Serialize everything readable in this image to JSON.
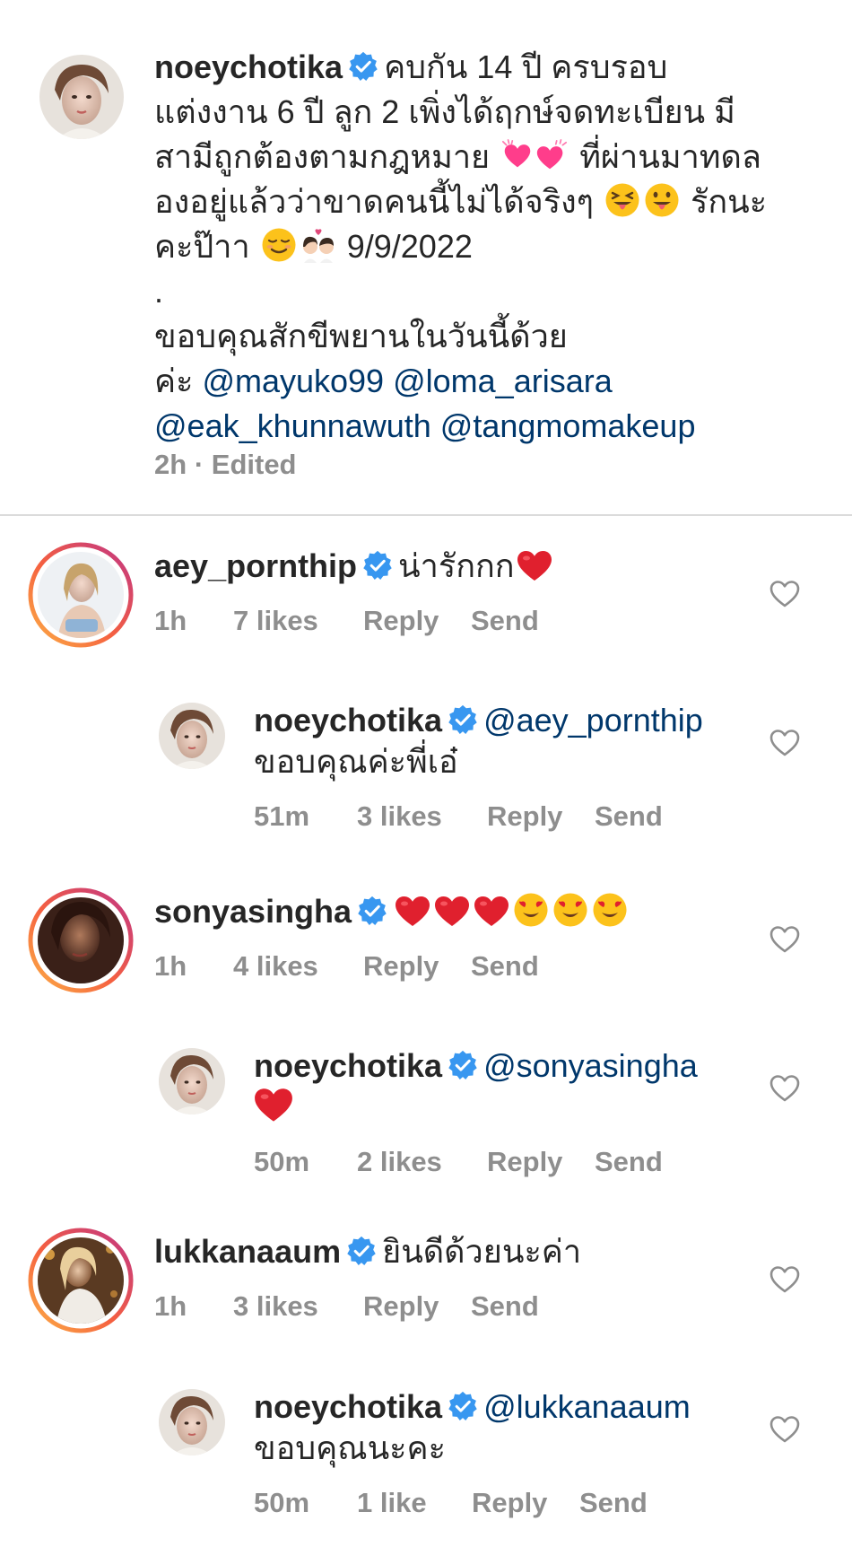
{
  "caption": {
    "username": "noeychotika",
    "line1": "คบกัน 14 ปี ครบรอบ",
    "line2": "แต่งงาน 6 ปี ลูก 2 เพิ่งได้ฤกษ์จดทะเบียน มี",
    "line3a": "สามีถูกต้องตามกฎหมาย",
    "line3b": "ที่ผ่านมาทดล",
    "line4a": "องอยู่แล้วว่าขาดคนนี้ไม่ได้จริงๆ",
    "line4b": "รักนะ",
    "line5a": "คะป๊าา",
    "line5b": "9/9/2022",
    "line6": ".",
    "line7": "ขอบคุณสักขีพยานในวันนี้ด้วย",
    "line8a": "ค่ะ",
    "mentions": [
      "@mayuko99",
      "@loma_arisara",
      "@eak_khunnawuth",
      "@tangmomakeup"
    ],
    "time": "2h",
    "edited": "Edited",
    "separator": "·"
  },
  "comments": [
    {
      "username": "aey_pornthip",
      "text": "น่ารักกก",
      "time": "1h",
      "likes": "7 likes",
      "reply": "Reply",
      "send": "Send"
    },
    {
      "username": "noeychotika",
      "mention": "@aey_pornthip",
      "text": "ขอบคุณค่ะพี่เอ๋",
      "time": "51m",
      "likes": "3 likes",
      "reply": "Reply",
      "send": "Send"
    },
    {
      "username": "sonyasingha",
      "text": "",
      "time": "1h",
      "likes": "4 likes",
      "reply": "Reply",
      "send": "Send"
    },
    {
      "username": "noeychotika",
      "mention": "@sonyasingha",
      "text": "",
      "time": "50m",
      "likes": "2 likes",
      "reply": "Reply",
      "send": "Send"
    },
    {
      "username": "lukkanaaum",
      "text": "ยินดีด้วยนะค่า",
      "time": "1h",
      "likes": "3 likes",
      "reply": "Reply",
      "send": "Send"
    },
    {
      "username": "noeychotika",
      "mention": "@lukkanaaum",
      "text": "ขอบคุณนะคะ",
      "time": "50m",
      "likes": "1 like",
      "reply": "Reply",
      "send": "Send"
    }
  ],
  "icons": {
    "verified": "verified-badge-icon",
    "heart": "heart-outline-icon"
  },
  "colors": {
    "text": "#262626",
    "secondary": "#8e8e8e",
    "mention": "#00376b",
    "verified": "#3897f0",
    "story_ring_start": "#f9a825",
    "story_ring_end": "#d81b8c",
    "emoji_heart": "#e0202e"
  }
}
